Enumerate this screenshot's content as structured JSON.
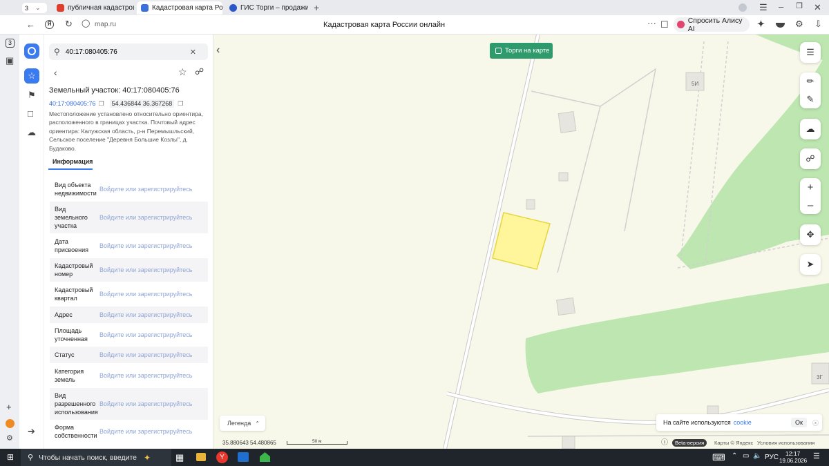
{
  "browser": {
    "tab_count": "3",
    "tabs": [
      {
        "label": "публичная кадастровая к",
        "fav_color": "#e03e2d"
      },
      {
        "label": "Кадастровая карта Рос",
        "fav_color": "#3b6fdc"
      },
      {
        "label": "ГИС Торги – продажи гос",
        "fav_color": "#2b57c9"
      }
    ],
    "url": "map.ru",
    "page_title": "Кадастровая карта России онлайн",
    "alice_label": "Спросить Алису AI"
  },
  "search": {
    "value": "40:17:080405:76"
  },
  "parcel": {
    "title": "Земельный участок: 40:17:080405:76",
    "number": "40:17:080405:76",
    "coords": "54.436844 36.367268",
    "description": "Местоположение установлено относительно ориентира, расположенного в границах участка. Почтовый адрес ориентира: Калужская область, р-н Перемышльский, Сельское поселение \"Деревня Большие Козлы\", д. Будаково."
  },
  "info_tab": "Информация",
  "login_text": "Войдите или зарегистрируйтесь",
  "info_rows": [
    {
      "key": "Вид объекта недвижимости"
    },
    {
      "key": "Вид земельного участка"
    },
    {
      "key": "Дата присвоения"
    },
    {
      "key": "Кадастровый номер"
    },
    {
      "key": "Кадастровый квартал"
    },
    {
      "key": "Адрес"
    },
    {
      "key": "Площадь уточненная"
    },
    {
      "key": "Статус"
    },
    {
      "key": "Категория земель"
    },
    {
      "key": "Вид разрешенного использования"
    },
    {
      "key": "Форма собственности"
    }
  ],
  "map": {
    "torgi_label": "Торги на карте",
    "legend_label": "Легенда",
    "cursor_coords": "35.880643 54.480865",
    "scale_label": "50 м",
    "house_5i": "5И",
    "house_3g": "3Г",
    "cookie_text": "На сайте используются",
    "cookie_link": "cookie",
    "cookie_ok": "Ок",
    "beta": "Beta-версия",
    "copyright": "Карты © Яндекс",
    "terms": "Условия использования",
    "accent": "#2f9b6c",
    "parcel_fill": "#fff59a",
    "forest": "#b9e3ac"
  },
  "taskbar": {
    "search_placeholder": "Чтобы начать поиск, введите",
    "lang": "РУС",
    "time": "12:17",
    "date": "19.06.2026"
  }
}
